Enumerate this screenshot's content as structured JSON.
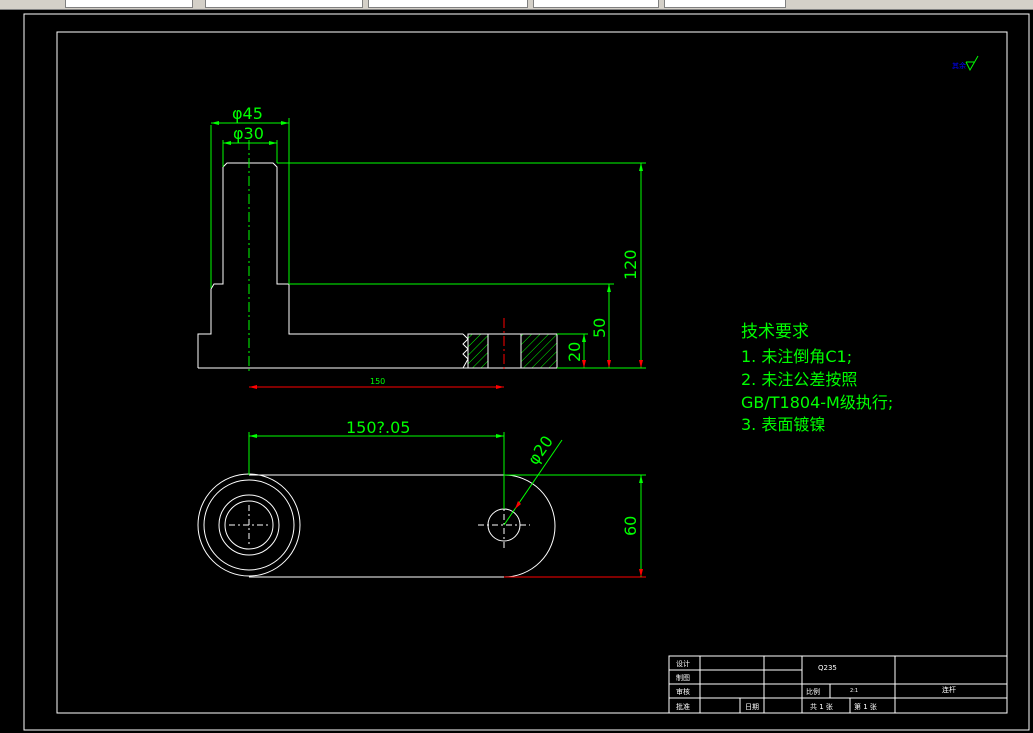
{
  "colors": {
    "background": "#000000",
    "outline": "#ffffff",
    "dimension": "#00ff00",
    "arrow": "#ff0000",
    "centerline": "#00ff00",
    "note": "#00ff00"
  },
  "dimensions": {
    "top_diameter_outer": "φ45",
    "top_diameter_inner": "φ30",
    "height_total": "120",
    "height_step": "50",
    "base_thickness": "20",
    "front_length": "150",
    "plan_length": "150?.05",
    "hole_diameter": "φ20",
    "plan_width": "60"
  },
  "notes": {
    "title": "技术要求",
    "line1": "1. 未注倒角C1;",
    "line2": "2. 未注公差按照",
    "line3": "GB/T1804-M级执行;",
    "line4": "3. 表面镀镍"
  },
  "roughness_mark": "其余",
  "title_block": {
    "material": "Q235",
    "scale_label": "比例",
    "scale_value": "2:1",
    "part_name": "连杆",
    "sheets_total": "共 1 张",
    "sheet_no": "第 1 张",
    "row_design": "设计",
    "row_draw": "制图",
    "row_check": "审核",
    "row_approve": "批准",
    "row_date": "日期"
  }
}
